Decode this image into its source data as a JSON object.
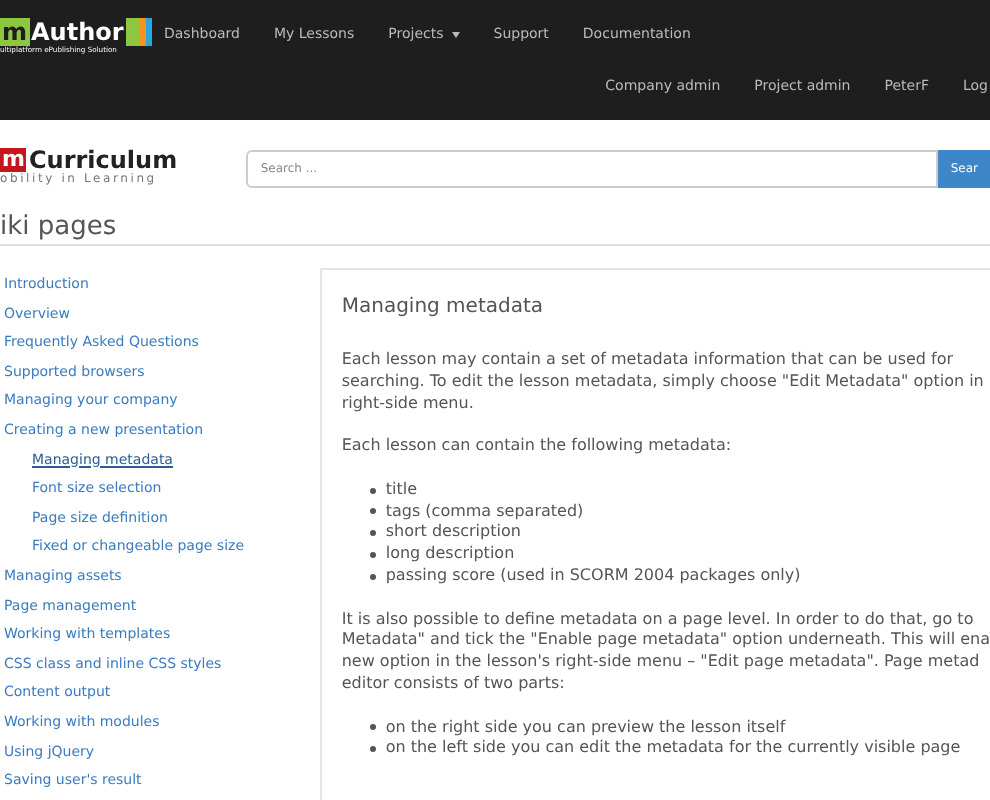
{
  "top_nav": {
    "logo": {
      "letter": "m",
      "name": "Author",
      "tagline": "ultiplatform ePublishing Solution"
    },
    "items": [
      {
        "label": "Dashboard",
        "dropdown": false
      },
      {
        "label": "My Lessons",
        "dropdown": false
      },
      {
        "label": "Projects",
        "dropdown": true
      },
      {
        "label": "Support",
        "dropdown": false
      },
      {
        "label": "Documentation",
        "dropdown": false
      }
    ],
    "user_items": [
      "Company admin",
      "Project admin",
      "PeterF",
      "Log"
    ]
  },
  "brand": {
    "letter": "m",
    "name": "Curriculum",
    "tagline": "obility in Learning"
  },
  "search": {
    "placeholder": "Search ...",
    "button": "Sear"
  },
  "page_title": "iki pages",
  "sidebar": {
    "items": [
      {
        "label": "Introduction",
        "selected": false
      },
      {
        "label": "Overview",
        "selected": false
      },
      {
        "label": "Frequently Asked Questions",
        "selected": false
      },
      {
        "label": "Supported browsers",
        "selected": false
      },
      {
        "label": "Managing your company",
        "selected": false
      },
      {
        "label": "Creating a new presentation",
        "selected": false,
        "children": [
          {
            "label": "Managing metadata",
            "selected": true
          },
          {
            "label": "Font size selection",
            "selected": false
          },
          {
            "label": "Page size definition",
            "selected": false
          },
          {
            "label": "Fixed or changeable page size",
            "selected": false
          }
        ]
      },
      {
        "label": "Managing assets",
        "selected": false
      },
      {
        "label": "Page management",
        "selected": false
      },
      {
        "label": "Working with templates",
        "selected": false
      },
      {
        "label": "CSS class and inline CSS styles",
        "selected": false
      },
      {
        "label": "Content output",
        "selected": false
      },
      {
        "label": "Working with modules",
        "selected": false
      },
      {
        "label": "Using jQuery",
        "selected": false
      },
      {
        "label": "Saving user's result",
        "selected": false
      }
    ]
  },
  "article": {
    "heading": "Managing metadata",
    "blocks": [
      {
        "kind": "paragraph",
        "lines": [
          "Each lesson may contain a set of metadata information that can be used for",
          "searching. To edit the lesson metadata, simply choose \"Edit Metadata\" option in",
          "right-side menu."
        ]
      },
      {
        "kind": "paragraph",
        "lines": [
          "Each lesson can contain the following metadata:"
        ]
      },
      {
        "kind": "list",
        "lines": [
          "title",
          "tags (comma separated)",
          "short description",
          "long description",
          "passing score (used in SCORM 2004 packages only)"
        ]
      },
      {
        "kind": "paragraph",
        "lines": [
          "It is also possible to define metadata on a page level. In order to do that, go to",
          "Metadata\" and tick the \"Enable page metadata\" option underneath. This will ena",
          "new option in the lesson's right-side menu – \"Edit page metadata\". Page metad",
          "editor consists of two parts:"
        ]
      },
      {
        "kind": "list",
        "lines": [
          "on the right side you can preview the lesson itself",
          "on the left side you can edit the metadata for the currently visible page"
        ]
      }
    ]
  }
}
